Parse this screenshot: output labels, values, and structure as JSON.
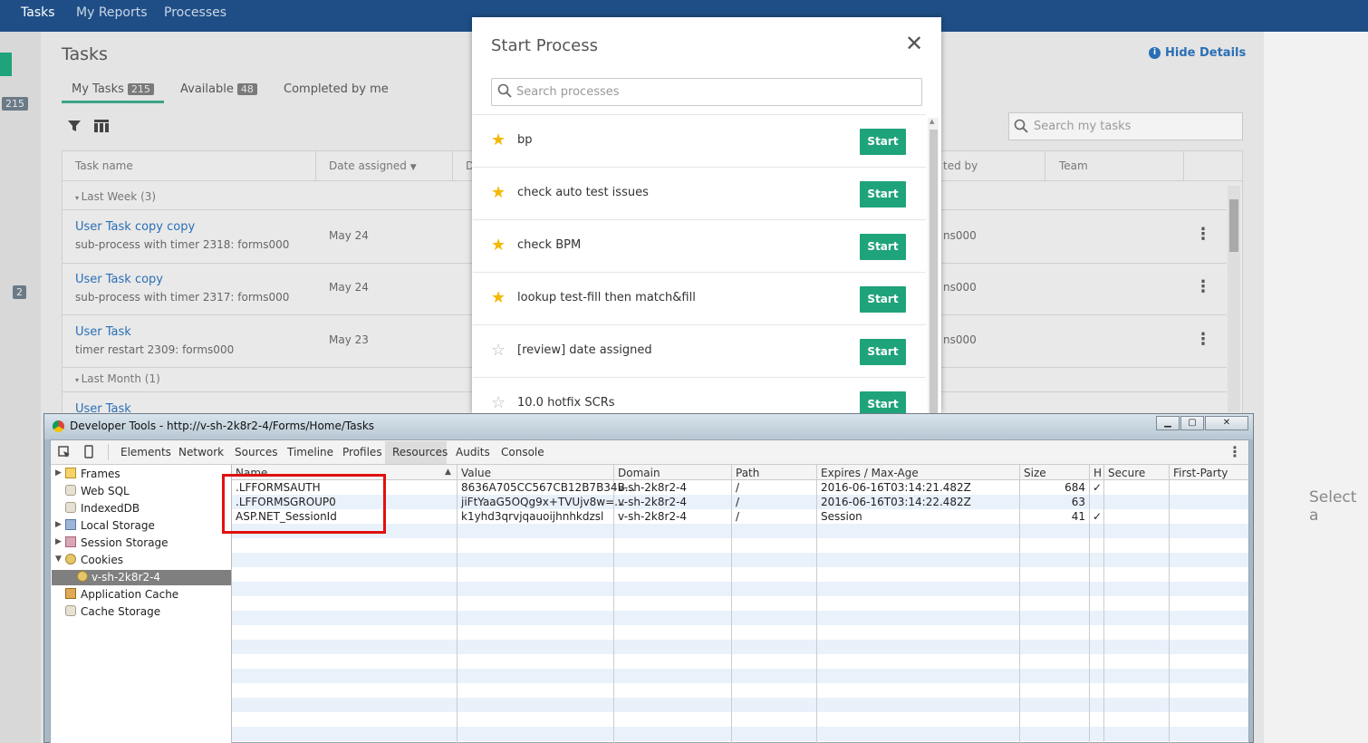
{
  "topnav": {
    "items": [
      "Tasks",
      "My Reports",
      "Processes"
    ]
  },
  "rail": {
    "badge_top": "215",
    "badge_bottom": "2"
  },
  "page": {
    "title": "Tasks",
    "tabs": [
      {
        "label": "My Tasks",
        "count": "215"
      },
      {
        "label": "Available",
        "count": "48"
      },
      {
        "label": "Completed by me"
      }
    ],
    "hide_details": "Hide Details",
    "search_placeholder": "Search my tasks",
    "right_placeholder": "Select a"
  },
  "table": {
    "headers": [
      "Task name",
      "Date assigned",
      "D",
      "ted by",
      "Team"
    ],
    "groups": [
      "Last Week (3)",
      "Last Month (1)"
    ],
    "rows": [
      {
        "title": "User Task copy copy",
        "subtitle": "sub-process with timer 2318: forms000",
        "date": "May 24",
        "by": "ns000"
      },
      {
        "title": "User Task copy",
        "subtitle": "sub-process with timer 2317: forms000",
        "date": "May 24",
        "by": "ns000"
      },
      {
        "title": "User Task",
        "subtitle": "timer restart 2309: forms000",
        "date": "May 23",
        "by": "ns000"
      }
    ],
    "partial_row": "User Task"
  },
  "modal": {
    "title": "Start Process",
    "search_placeholder": "Search processes",
    "start_label": "Start",
    "processes": [
      {
        "name": "bp",
        "starred": true
      },
      {
        "name": "check auto test issues",
        "starred": true
      },
      {
        "name": "check BPM",
        "starred": true
      },
      {
        "name": "lookup test-fill then match&fill",
        "starred": true
      },
      {
        "name": "[review] date assigned",
        "starred": false
      },
      {
        "name": "10.0 hotfix SCRs",
        "starred": false
      }
    ]
  },
  "devtools": {
    "title": "Developer Tools - http://v-sh-2k8r2-4/Forms/Home/Tasks",
    "tabs": [
      "Elements",
      "Network",
      "Sources",
      "Timeline",
      "Profiles",
      "Resources",
      "Audits",
      "Console"
    ],
    "active_tab": "Resources",
    "sidebar": {
      "frames": "Frames",
      "web_sql": "Web SQL",
      "indexeddb": "IndexedDB",
      "local_storage": "Local Storage",
      "session_storage": "Session Storage",
      "cookies": "Cookies",
      "cookie_domain": "v-sh-2k8r2-4",
      "app_cache": "Application Cache",
      "cache_storage": "Cache Storage"
    },
    "grid_headers": [
      "Name",
      "Value",
      "Domain",
      "Path",
      "Expires / Max-Age",
      "Size",
      "H",
      "Secure",
      "First-Party"
    ],
    "cookies": [
      {
        "name": ".LFFORMSAUTH",
        "value": "8636A705CC567CB12B7B34B...",
        "domain": "v-sh-2k8r2-4",
        "path": "/",
        "expires": "2016-06-16T03:14:21.482Z",
        "size": "684",
        "http": "✓"
      },
      {
        "name": ".LFFORMSGROUP0",
        "value": "jiFtYaaG5OQg9x+TVUjv8w=...",
        "domain": "v-sh-2k8r2-4",
        "path": "/",
        "expires": "2016-06-16T03:14:22.482Z",
        "size": "63",
        "http": ""
      },
      {
        "name": "ASP.NET_SessionId",
        "value": "k1yhd3qrvjqauoijhnhkdzsl",
        "domain": "v-sh-2k8r2-4",
        "path": "/",
        "expires": "Session",
        "size": "41",
        "http": "✓"
      }
    ]
  },
  "colors": {
    "nav": "#1f4e86",
    "accent": "#1fa37b",
    "link": "#2a6fb5",
    "highlight_box": "#e01010",
    "star": "#f5b800"
  }
}
